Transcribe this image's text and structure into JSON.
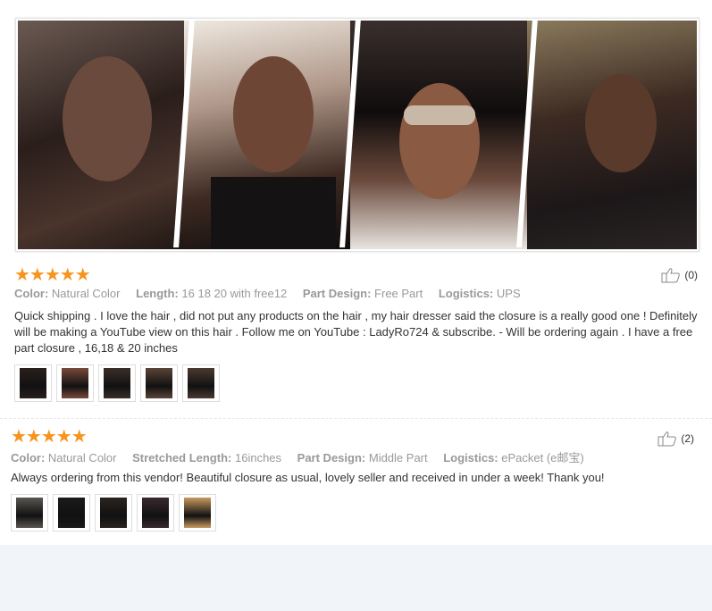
{
  "collage": {
    "photos": [
      {
        "name": "photo-straight-hair"
      },
      {
        "name": "photo-curly-hair-team-live-shirt"
      },
      {
        "name": "photo-curly-hair-sunglasses"
      },
      {
        "name": "photo-curly-bob"
      }
    ]
  },
  "reviews": [
    {
      "stars": "★★★★★",
      "helpful_count": "(0)",
      "attributes": [
        {
          "label": "Color:",
          "value": "Natural Color"
        },
        {
          "label": "Length:",
          "value": "16 18 20 with free12"
        },
        {
          "label": "Part Design:",
          "value": "Free Part"
        },
        {
          "label": "Logistics:",
          "value": "UPS"
        }
      ],
      "text": "Quick shipping . I love the hair , did not put any products on the hair , my hair dresser said the closure is a really good one ! Definitely will be making a YouTube view on this hair . Follow me on YouTube : LadyRo724 & subscribe. - Will be ordering again . I have a free part closure , 16,18 & 20 inches",
      "thumb_colors": [
        "#2a1f1c",
        "#7a4a3a",
        "#3a2e28",
        "#5a4438",
        "#4a3a30"
      ]
    },
    {
      "stars": "★★★★★",
      "helpful_count": "(2)",
      "attributes": [
        {
          "label": "Color:",
          "value": "Natural Color"
        },
        {
          "label": "Stretched Length:",
          "value": "16inches"
        },
        {
          "label": "Part Design:",
          "value": "Middle Part"
        },
        {
          "label": "Logistics:",
          "value": "ePacket (e邮宝)"
        }
      ],
      "text": "Always ordering from this vendor! Beautiful closure as usual, lovely seller and received in under a week! Thank you!",
      "thumb_colors": [
        "#5a5652",
        "#1c1a1a",
        "#2a2420",
        "#3a2a30",
        "#c89a60"
      ]
    }
  ]
}
